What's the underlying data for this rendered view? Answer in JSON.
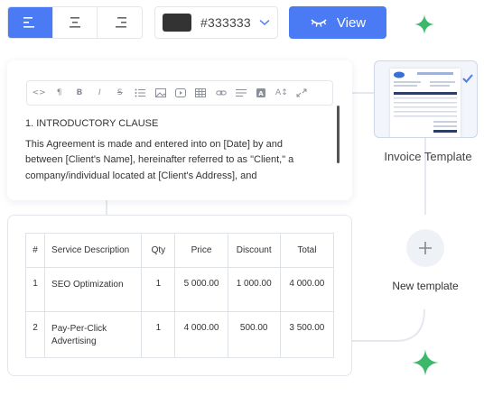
{
  "toolbar": {
    "align_buttons": [
      {
        "id": "left",
        "icon": "align-left-icon",
        "active": true
      },
      {
        "id": "center",
        "icon": "align-center-icon",
        "active": false
      },
      {
        "id": "right",
        "icon": "align-right-icon",
        "active": false
      }
    ],
    "color": {
      "value": "#333333",
      "swatch": "#333333"
    },
    "view_label": "View",
    "accent": "#4a7bf4",
    "sparkle_color": "#3bb86a"
  },
  "editor": {
    "tools": [
      "code-icon",
      "paragraph-icon",
      "bold-icon",
      "italic-icon",
      "strikethrough-icon",
      "list-icon",
      "image-icon",
      "video-icon",
      "table-icon",
      "link-icon",
      "align-icon",
      "text-color-icon",
      "font-size-icon",
      "fullscreen-icon"
    ],
    "heading": "1. INTRODUCTORY CLAUSE",
    "body_lines": [
      "This Agreement is made and entered into on [Date] by and",
      "between [Client's Name], hereinafter referred to as \"Client,\" a",
      "company/individual located at  [Client's Address], and"
    ]
  },
  "invoice_table": {
    "headers": [
      "#",
      "Service Description",
      "Qty",
      "Price",
      "Discount",
      "Total"
    ],
    "rows": [
      {
        "num": "1",
        "desc": [
          "SEO Optimization"
        ],
        "qty": "1",
        "price": "5 000.00",
        "discount": "1 000.00",
        "total": "4 000.00"
      },
      {
        "num": "2",
        "desc": [
          "Pay-Per-Click",
          "Advertising"
        ],
        "qty": "1",
        "price": "4 000.00",
        "discount": "500.00",
        "total": "3 500.00"
      }
    ]
  },
  "templates": {
    "selected_label": "Invoice Template",
    "new_label": "New template"
  }
}
